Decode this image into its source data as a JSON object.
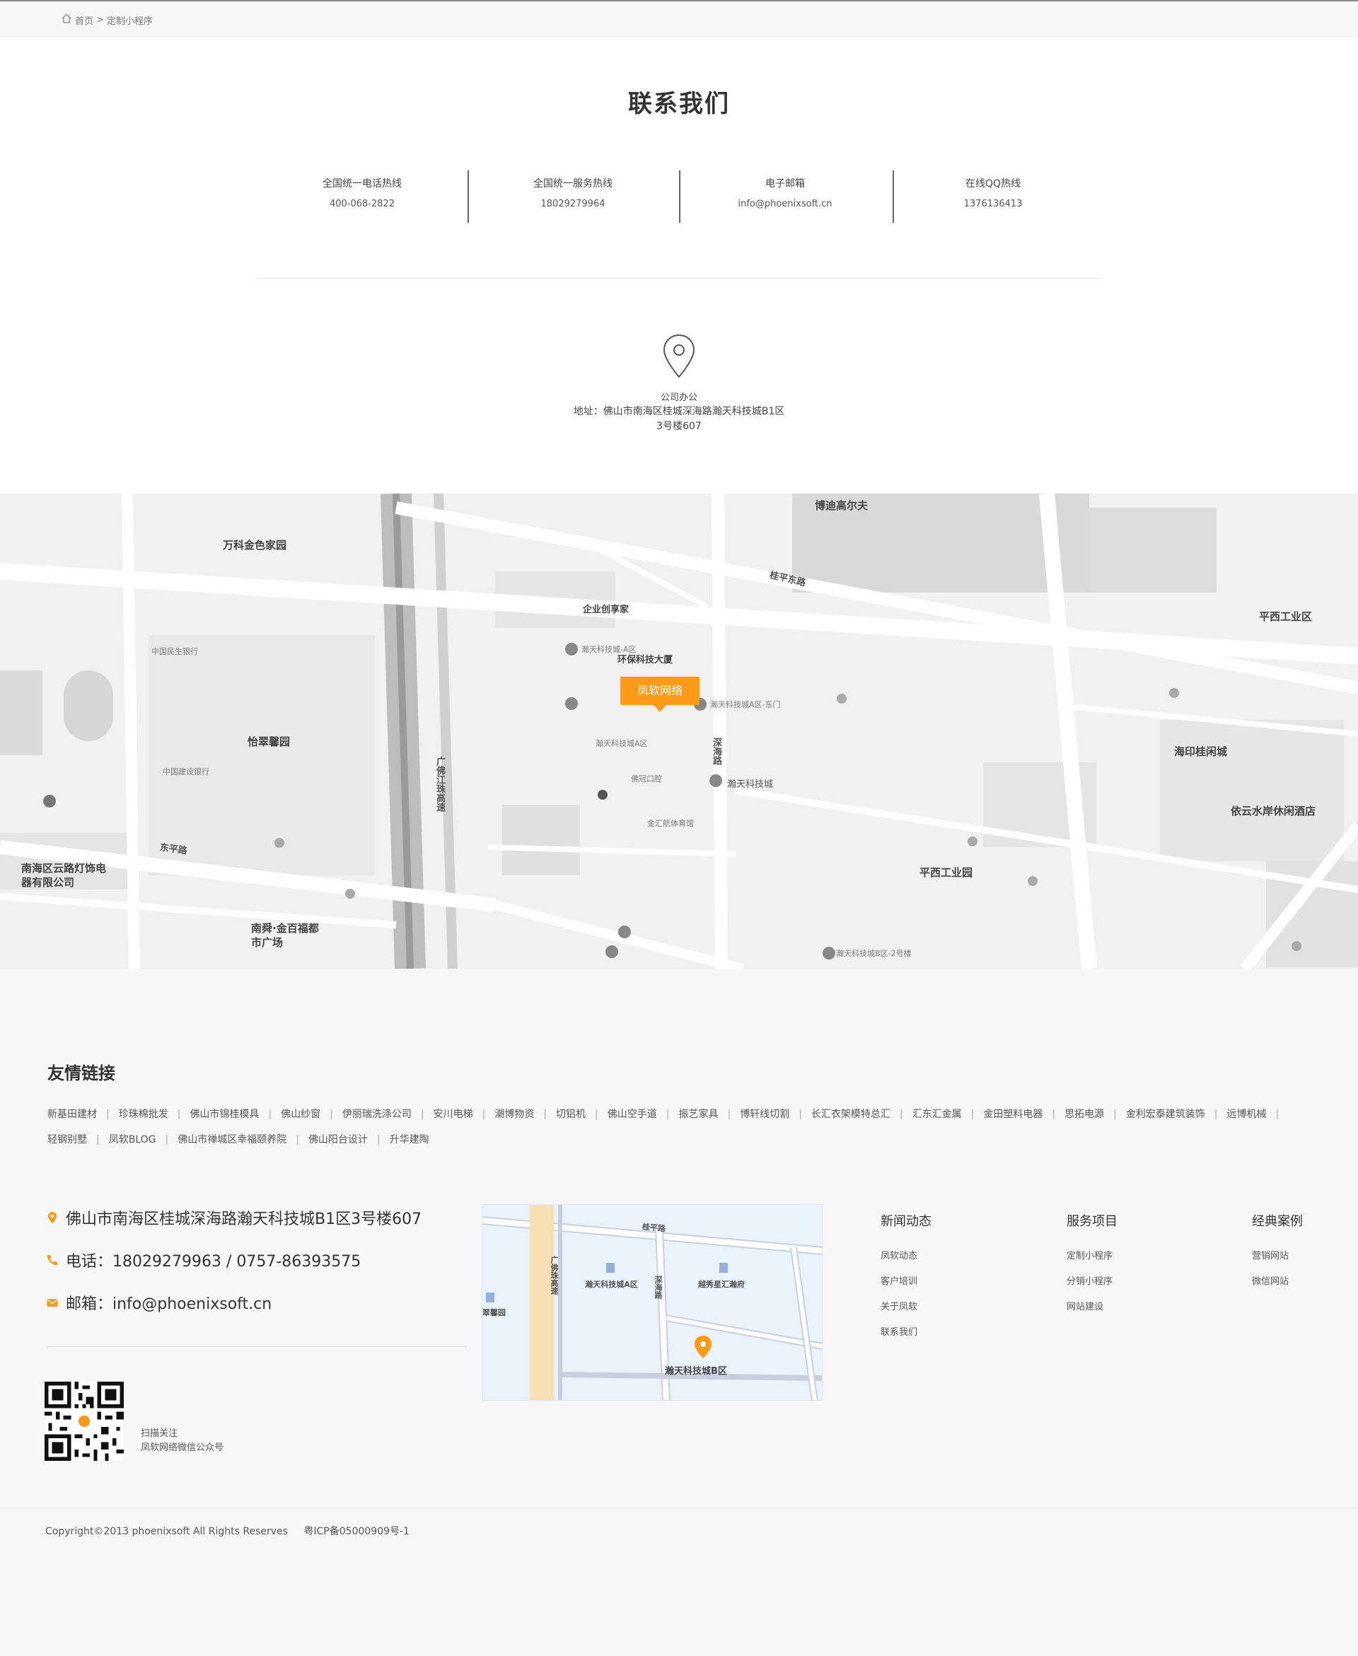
{
  "breadcrumb": {
    "home": "首页",
    "separator": ">",
    "current": "定制小程序"
  },
  "contact": {
    "title": "联系我们",
    "hotlines": [
      {
        "label": "全国统一电话热线",
        "value": "400-068-2822"
      },
      {
        "label": "全国统一服务热线",
        "value": "18029279964"
      },
      {
        "label": "电子邮箱",
        "value": "info@phoenixsoft.cn"
      },
      {
        "label": "在线QQ热线",
        "value": "1376136413"
      }
    ],
    "office_title": "公司办公",
    "office_address": "地址：佛山市南海区桂城深海路瀚天科技城B1区3号楼607"
  },
  "map": {
    "marker_label": "凤软网络",
    "labels": [
      "博迪高尔夫",
      "万科金色家园",
      "企业创享家",
      "环保科技大厦",
      "怡翠馨园",
      "瀚天科技城",
      "海印桂闲城",
      "依云水岸休闲酒店",
      "平西工业区",
      "平西工业园",
      "南海区云路灯饰电器有限公司",
      "南舜·金百福都市广场",
      "桂平东路",
      "东平路",
      "深海路",
      "广佛江珠高速",
      "瀚天科技城-A区",
      "瀚天科技城A区-东门",
      "瀚天科技城A区",
      "瀚天科技城B区-2号楼",
      "中国民生银行",
      "中国建设银行",
      "佛冠口腔",
      "金汇航体育馆"
    ]
  },
  "friends": {
    "title": "友情链接",
    "separator": "|",
    "links": [
      "新基田建材",
      "珍珠棉批发",
      "佛山市锦桂模具",
      "佛山纱窗",
      "伊丽瑞洗涤公司",
      "安川电梯",
      "潮博物资",
      "切铝机",
      "佛山空手道",
      "振艺家具",
      "博轩线切割",
      "长汇衣架模特总汇",
      "汇东汇金属",
      "金田塑料电器",
      "思拓电源",
      "金利宏泰建筑装饰",
      "远博机械",
      "轻钢别墅",
      "凤软BLOG",
      "佛山市禅城区幸福颐养院",
      "佛山阳台设计",
      "升华建陶"
    ]
  },
  "footer": {
    "address": "佛山市南海区桂城深海路瀚天科技城B1区3号楼607",
    "phone": "电话：18029279963 / 0757-86393575",
    "email": "邮箱：info@phoenixsoft.cn",
    "qr_line1": "扫描关注",
    "qr_line2": "凤软网络微信公众号",
    "mini_map": {
      "labels": [
        "桂平路",
        "广佛珠高速",
        "瀚天科技城A区",
        "深海路",
        "越秀星汇瀚府",
        "翠馨园",
        "瀚天科技城B区"
      ]
    },
    "columns": [
      {
        "title": "新闻动态",
        "items": [
          "凤软动态",
          "客户培训",
          "关于凤软",
          "联系我们"
        ]
      },
      {
        "title": "服务项目",
        "items": [
          "定制小程序",
          "分销小程序",
          "网站建设"
        ]
      },
      {
        "title": "经典案例",
        "items": [
          "营销网站",
          "微信网站"
        ]
      }
    ],
    "copyright": "Copyright©2013 phoenixsoft All Rights Reserves",
    "icp": "粤ICP备05000909号-1"
  },
  "colors": {
    "accent": "#ff9a16",
    "background": "#f7f7f7"
  }
}
